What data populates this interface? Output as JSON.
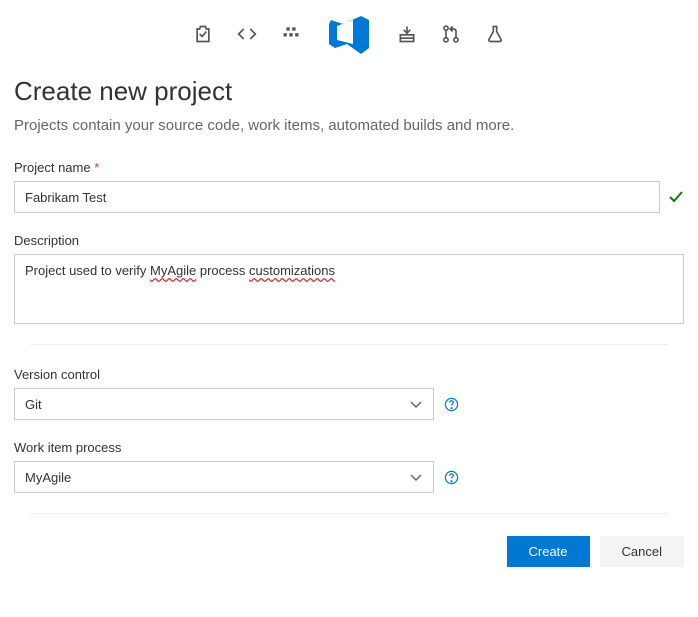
{
  "header": {
    "title": "Create new project",
    "subtitle": "Projects contain your source code, work items, automated builds and more."
  },
  "fields": {
    "project_name": {
      "label": "Project name",
      "required_mark": "*",
      "value": "Fabrikam Test"
    },
    "description": {
      "label": "Description",
      "value_prefix": "Project used to verify ",
      "value_word1": "MyAgile",
      "value_mid": " process ",
      "value_word2": "customizations"
    },
    "version_control": {
      "label": "Version control",
      "selected": "Git"
    },
    "work_item_process": {
      "label": "Work item process",
      "selected": "MyAgile"
    }
  },
  "actions": {
    "create": "Create",
    "cancel": "Cancel"
  },
  "colors": {
    "primary": "#0078d4",
    "success": "#107c10",
    "danger": "#d13438"
  }
}
